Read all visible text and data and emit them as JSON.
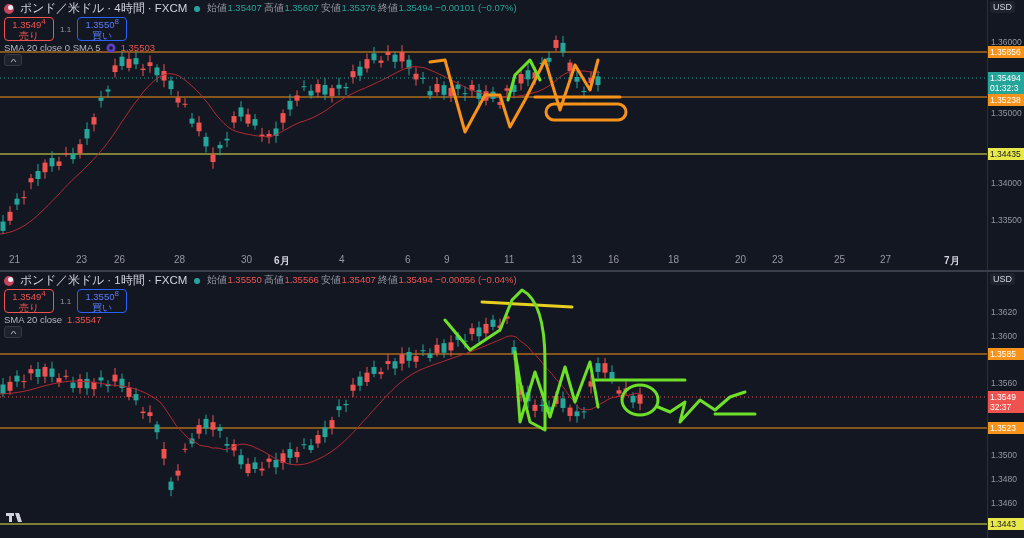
{
  "panes": [
    {
      "symbol": "ポンド／米ドル · 4時間 · FXCM",
      "ohlc": [
        {
          "label": "始値",
          "value": "1.35407"
        },
        {
          "label": "高値",
          "value": "1.35607"
        },
        {
          "label": "安値",
          "value": "1.35376"
        },
        {
          "label": "終値",
          "value": "1.35494"
        }
      ],
      "change": "−0.00101 (−0.07%)",
      "sell": {
        "price": "1.3549$^{4}$",
        "label": "売り"
      },
      "spread": "1.1",
      "buy": {
        "price": "1.3550$^{8}$",
        "label": "買い"
      },
      "indicator": {
        "name": "SMA 20 close 0 SMA 5",
        "value": "1.35503",
        "settings_icon": true
      },
      "currency": "USD",
      "price_ticks": [
        "1.36000",
        "1.35000",
        "1.34000",
        "1.33500"
      ],
      "price_markers": [
        {
          "price": "1.35856",
          "color": "#f7931a"
        },
        {
          "price": "1.35494",
          "sub": "01:32:3",
          "color": "#26a69a"
        },
        {
          "price": "1.35238",
          "color": "#f7931a"
        },
        {
          "price": "1.34435",
          "color": "#e8e84a"
        }
      ],
      "time_ticks": [
        {
          "label": "21",
          "month_start": false
        },
        {
          "label": "23",
          "month_start": false
        },
        {
          "label": "26",
          "month_start": false
        },
        {
          "label": "28",
          "month_start": false
        },
        {
          "label": "30",
          "month_start": false
        },
        {
          "label": "6月",
          "month_start": true
        },
        {
          "label": "4",
          "month_start": false
        },
        {
          "label": "6",
          "month_start": false
        },
        {
          "label": "9",
          "month_start": false
        },
        {
          "label": "11",
          "month_start": false
        },
        {
          "label": "13",
          "month_start": false
        },
        {
          "label": "16",
          "month_start": false
        },
        {
          "label": "18",
          "month_start": false
        },
        {
          "label": "20",
          "month_start": false
        },
        {
          "label": "23",
          "month_start": false
        },
        {
          "label": "25",
          "month_start": false
        },
        {
          "label": "27",
          "month_start": false
        },
        {
          "label": "7月",
          "month_start": true
        }
      ]
    },
    {
      "symbol": "ポンド／米ドル · 1時間 · FXCM",
      "ohlc": [
        {
          "label": "始値",
          "value": "1.35550"
        },
        {
          "label": "高値",
          "value": "1.35566"
        },
        {
          "label": "安値",
          "value": "1.35407"
        },
        {
          "label": "終値",
          "value": "1.35494"
        }
      ],
      "change": "−0.00056 (−0.04%)",
      "sell": {
        "price": "1.3549$^{4}$",
        "label": "売り"
      },
      "spread": "1.1",
      "buy": {
        "price": "1.3550$^{8}$",
        "label": "買い"
      },
      "indicator": {
        "name": "SMA 20 close",
        "value": "1.35547"
      },
      "currency": "USD",
      "price_ticks": [
        "1.3620",
        "1.3600",
        "1.3560",
        "1.3500",
        "1.3480",
        "1.3460"
      ],
      "price_markers": [
        {
          "price": "1.3585",
          "color": "#f7931a"
        },
        {
          "price": "1.3549",
          "sub": "32:37",
          "color": "#ef5350"
        },
        {
          "price": "1.3523",
          "color": "#f7931a"
        },
        {
          "price": "1.3443",
          "color": "#e8e84a"
        }
      ]
    }
  ]
}
